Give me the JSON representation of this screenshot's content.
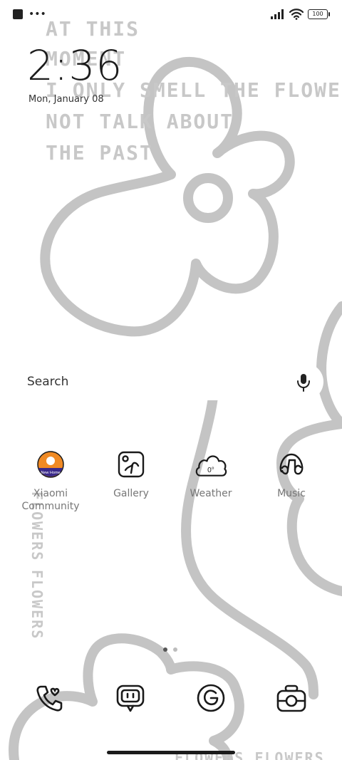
{
  "status_bar": {
    "battery": "100"
  },
  "lockscreen": {
    "time": "2:36",
    "date": "Mon, January 08"
  },
  "wallpaper": {
    "lines": [
      "AT THIS",
      "MOMENT",
      "I ONLY SMELL THE FLOWERS",
      "NOT TALK ABOUT",
      "THE PAST"
    ],
    "side_word_1": "FLOWERS",
    "side_word_2": "FLOWERS",
    "bottom_word": "FLOWERS FLOWERS"
  },
  "search": {
    "label": "Search"
  },
  "apps": [
    {
      "name": "Xiaomi Community",
      "icon": "xiaomi-community-icon",
      "badge": "New Home"
    },
    {
      "name": "Gallery",
      "icon": "gallery-icon"
    },
    {
      "name": "Weather",
      "icon": "weather-icon",
      "temp": "0°"
    },
    {
      "name": "Music",
      "icon": "music-icon"
    }
  ],
  "dock": [
    {
      "icon": "phone-icon"
    },
    {
      "icon": "messages-icon"
    },
    {
      "icon": "browser-icon"
    },
    {
      "icon": "camera-icon"
    }
  ],
  "pagination": {
    "pages": 2,
    "current": 1
  },
  "colors": {
    "wallpaper_stroke": "#c4c4c4",
    "icon_stroke": "#1a1a1a"
  }
}
